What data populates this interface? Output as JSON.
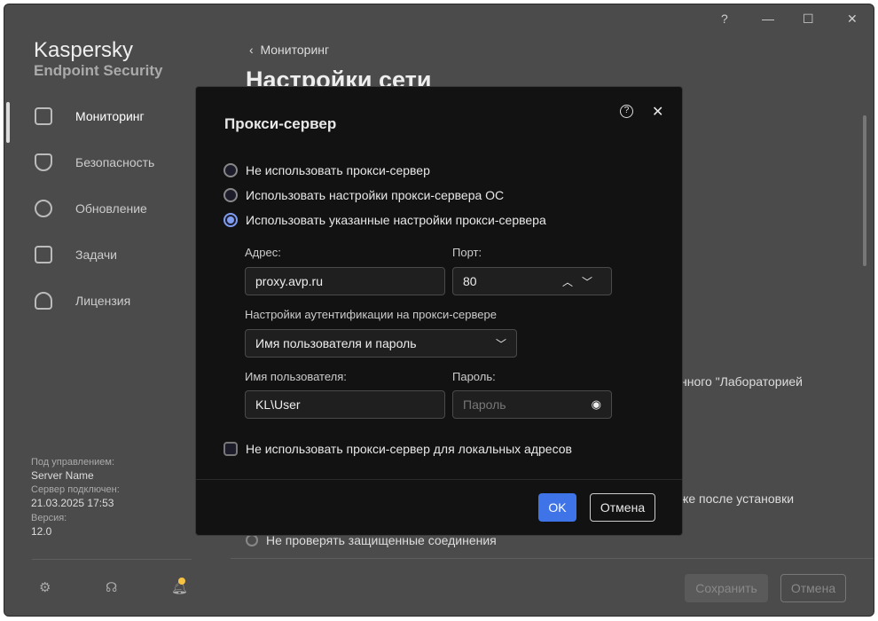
{
  "window": {
    "help": "?",
    "minimize": "—",
    "maximize": "☐",
    "close": "✕"
  },
  "app": {
    "name": "Kaspersky",
    "product": "Endpoint Security"
  },
  "sidebar": {
    "items": [
      {
        "label": "Мониторинг",
        "icon": "grid-icon"
      },
      {
        "label": "Безопасность",
        "icon": "shield-icon"
      },
      {
        "label": "Обновление",
        "icon": "refresh-icon"
      },
      {
        "label": "Задачи",
        "icon": "clipboard-icon"
      },
      {
        "label": "Лицензия",
        "icon": "award-icon"
      }
    ],
    "managed_label": "Под управлением:",
    "managed_value": "Server Name",
    "connected_label": "Сервер подключен:",
    "connected_value": "21.03.2025 17:53",
    "version_label": "Версия:",
    "version_value": "12.0"
  },
  "page": {
    "breadcrumb": "Мониторинг",
    "title": "Настройки сети",
    "bg_text1": "нного \"Лабораторией",
    "bg_text2": "же после установки",
    "bg_radio": "Не проверять защищенные соединения",
    "save": "Сохранить",
    "cancel": "Отмена"
  },
  "dialog": {
    "title": "Прокси-сервер",
    "options": [
      "Не использовать прокси-сервер",
      "Использовать настройки прокси-сервера ОС",
      "Использовать указанные настройки прокси-сервера"
    ],
    "selected": 2,
    "address_label": "Адрес:",
    "address_value": "proxy.avp.ru",
    "port_label": "Порт:",
    "port_value": "80",
    "auth_label": "Настройки аутентификации на прокси-сервере",
    "auth_value": "Имя пользователя и пароль",
    "user_label": "Имя пользователя:",
    "user_value": "KL\\User",
    "password_label": "Пароль:",
    "password_placeholder": "Пароль",
    "local_bypass": "Не использовать прокси-сервер для локальных адресов",
    "local_bypass_checked": false,
    "ok": "OK",
    "cancel": "Отмена"
  },
  "colors": {
    "accent": "#3f73e8",
    "notification": "#f5c242"
  }
}
